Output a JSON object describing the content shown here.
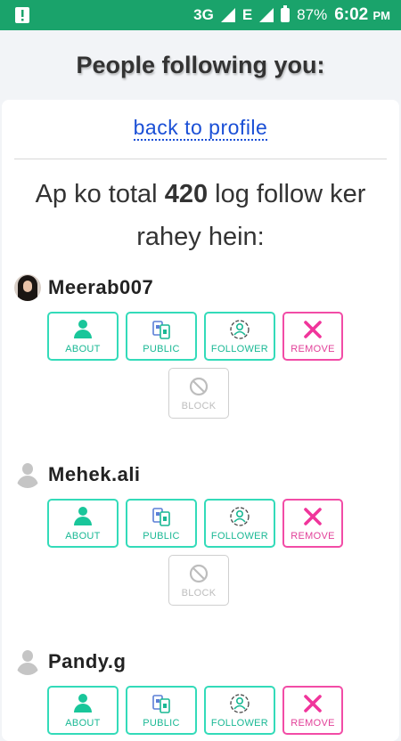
{
  "status_bar": {
    "network": "3G",
    "data_type": "E",
    "battery": "87%",
    "time": "6:02",
    "ampm": "PM",
    "colors": {
      "bar": "#1aa36b"
    }
  },
  "header": {
    "title": "People following you:"
  },
  "back_link": "back to profile",
  "intro": {
    "before": "Ap ko total ",
    "count": "420",
    "after": " log follow ker rahey hein:"
  },
  "buttons": {
    "about": "ABOUT",
    "public": "PUBLIC",
    "follower": "FOLLOWER",
    "remove": "REMOVE",
    "block": "BLOCK"
  },
  "followers": [
    {
      "username": "Meerab007",
      "avatar": "photo"
    },
    {
      "username": "Mehek.ali",
      "avatar": "default"
    },
    {
      "username": "Pandy.g",
      "avatar": "default"
    }
  ],
  "icons": {
    "about": "user-icon",
    "public": "phone-icon",
    "follower": "follower-icon",
    "remove": "x-icon",
    "block": "block-icon"
  },
  "colors": {
    "accent": "#33dbb9",
    "remove": "#f24ca6",
    "link": "#1a4fd6"
  }
}
